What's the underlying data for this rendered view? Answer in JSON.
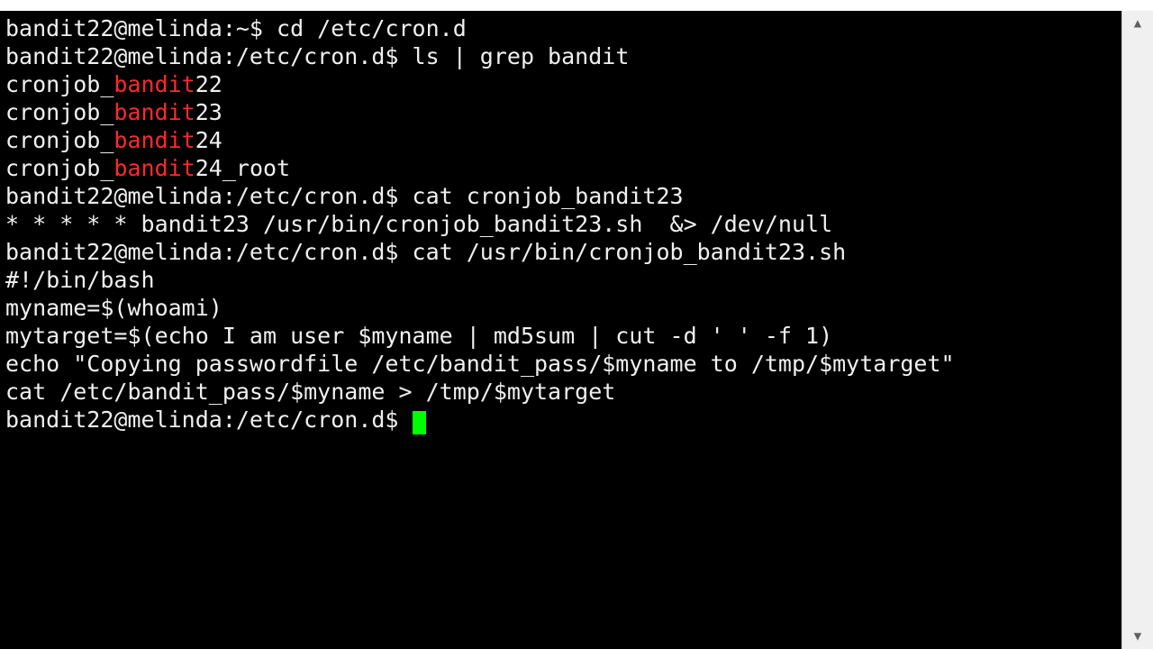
{
  "prompt_home": "bandit22@melinda:~$ ",
  "prompt_crond": "bandit22@melinda:/etc/cron.d$ ",
  "cmd1": "cd /etc/cron.d",
  "cmd2": "ls | grep bandit",
  "ls_results": {
    "prefix": "cronjob_",
    "match": "bandit",
    "rows": [
      {
        "suffix": "22"
      },
      {
        "suffix": "23"
      },
      {
        "suffix": "24"
      },
      {
        "suffix": "24_root"
      }
    ]
  },
  "cmd3": "cat cronjob_bandit23",
  "cron_line": "* * * * * bandit23 /usr/bin/cronjob_bandit23.sh  &> /dev/null",
  "cmd4": "cat /usr/bin/cronjob_bandit23.sh",
  "script": {
    "shebang": "#!/bin/bash",
    "l_blank1": "",
    "l_myname": "myname=$(whoami)",
    "l_mytarget": "mytarget=$(echo I am user $myname | md5sum | cut -d ' ' -f 1)",
    "l_blank2": "",
    "l_echo": "echo \"Copying passwordfile /etc/bandit_pass/$myname to /tmp/$mytarget\"",
    "l_blank3": "",
    "l_cat": "cat /etc/bandit_pass/$myname > /tmp/$mytarget"
  },
  "scrollbar": {
    "up_glyph": "▲",
    "down_glyph": "▼"
  }
}
